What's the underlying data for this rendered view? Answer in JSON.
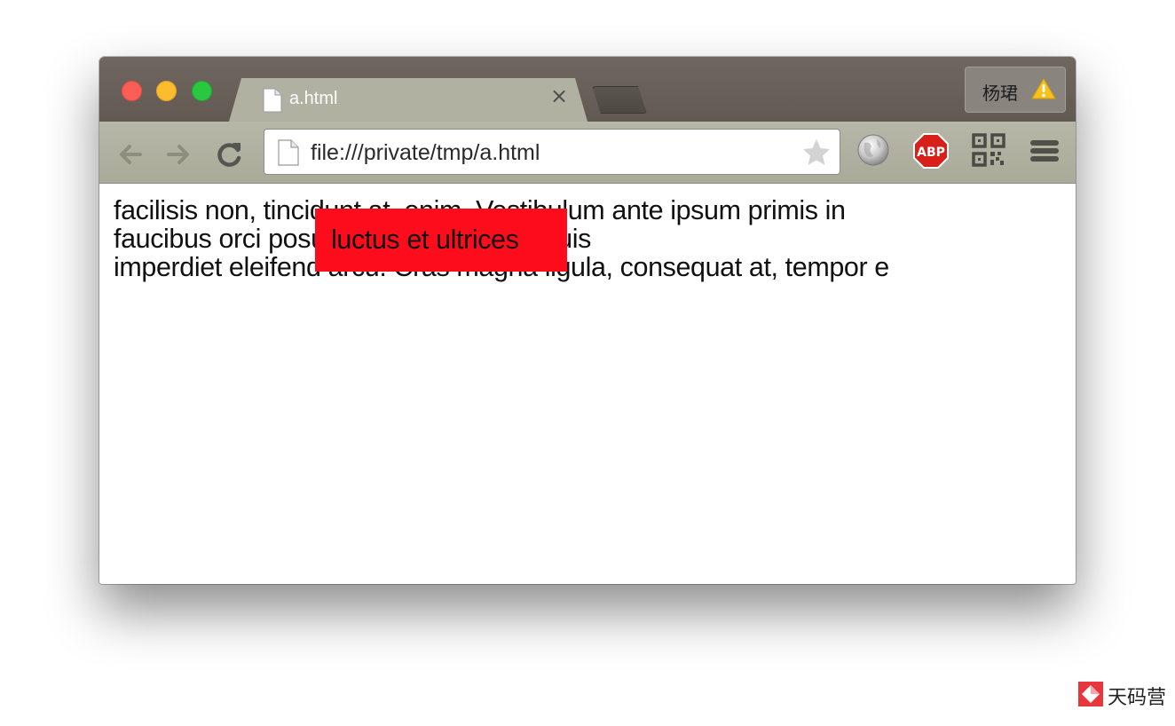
{
  "browser": {
    "tab": {
      "title": "a.html",
      "close_glyph": "×",
      "icon": "document-icon"
    },
    "new_tab": {
      "icon": "new-tab-icon"
    },
    "profile": {
      "name": "杨珺",
      "icon": "warning-icon"
    },
    "toolbar": {
      "back_icon": "back-arrow-icon",
      "forward_icon": "forward-arrow-icon",
      "reload_icon": "reload-icon",
      "url": "file:///private/tmp/a.html",
      "page_icon": "document-icon",
      "bookmark_icon": "star-icon",
      "extensions": [
        "globe-icon",
        "adblock-plus-icon",
        "qr-code-icon"
      ],
      "abp_label": "ABP",
      "menu_icon": "hamburger-menu-icon"
    }
  },
  "page": {
    "lines": [
      "facilisis non, tincidunt at, enim. Vestibulum ante ipsum primis in",
      "faucibus orci               posuere cubilia Curae; Duis",
      "imperdiet eleifend arcu. Cras magna ligula, consequat at, tempor e"
    ],
    "highlight_text": "luctus et ultrices",
    "highlight_color": "#fd0d1b"
  },
  "watermark": {
    "text": "天码营"
  },
  "colors": {
    "titlebar": "#6a625a",
    "tab": "#b0b1a0",
    "toolbar": "#b0b1a0",
    "close": "#fc5e57",
    "minimize": "#fdbc2e",
    "zoom": "#29c840"
  }
}
